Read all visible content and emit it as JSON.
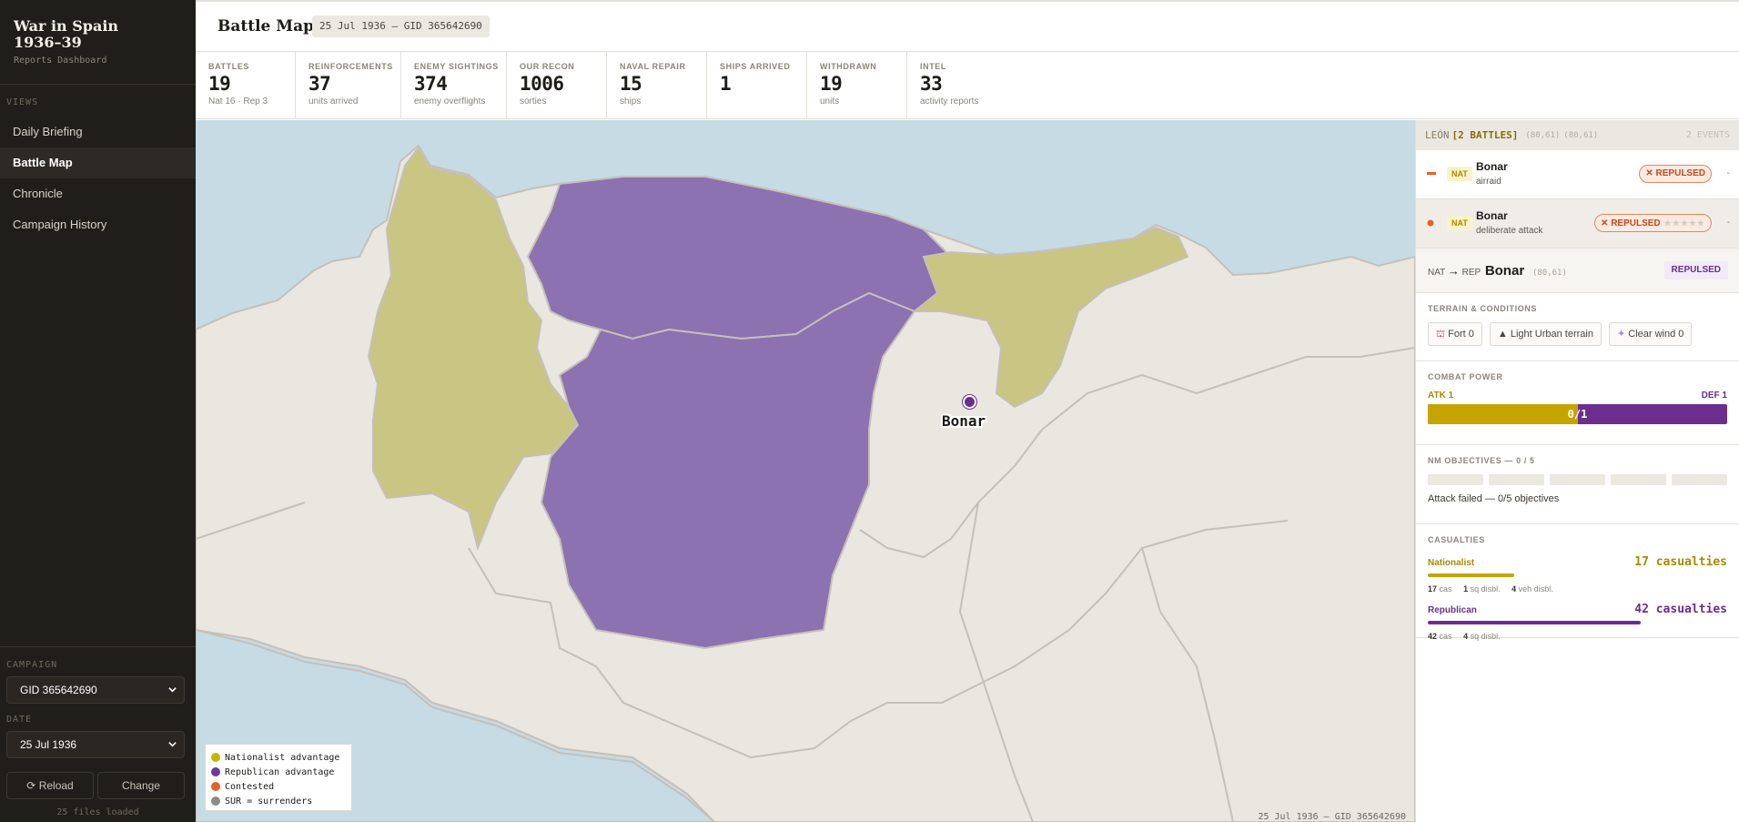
{
  "sidebar": {
    "brand_title": "War in Spain 1936–39",
    "brand_sub": "Reports Dashboard",
    "views_label": "VIEWS",
    "nav": [
      {
        "label": "Daily Briefing"
      },
      {
        "label": "Battle Map",
        "active": true
      },
      {
        "label": "Chronicle"
      },
      {
        "label": "Campaign History"
      }
    ],
    "campaign_label": "CAMPAIGN",
    "campaign_value": "GID 365642690",
    "date_label": "DATE",
    "date_value": "25 Jul 1936",
    "reload_label": "Reload",
    "change_label": "Change",
    "files_loaded": "25 files loaded"
  },
  "header": {
    "title": "Battle Map",
    "tag": "25 Jul 1936 — GID 365642690"
  },
  "stats": [
    {
      "label": "BATTLES",
      "value": "19",
      "sub": "Nat 16 · Rep 3"
    },
    {
      "label": "REINFORCEMENTS",
      "value": "37",
      "sub": "units arrived"
    },
    {
      "label": "ENEMY SIGHTINGS",
      "value": "374",
      "sub": "enemy overflights"
    },
    {
      "label": "OUR RECON",
      "value": "1006",
      "sub": "sorties"
    },
    {
      "label": "NAVAL REPAIR",
      "value": "15",
      "sub": "ships"
    },
    {
      "label": "SHIPS ARRIVED",
      "value": "1",
      "sub": ""
    },
    {
      "label": "WITHDRAWN",
      "value": "19",
      "sub": "units"
    },
    {
      "label": "INTEL",
      "value": "33",
      "sub": "activity reports"
    }
  ],
  "map": {
    "marker_label": "Bonar",
    "footer": "25 Jul 1936 — GID 365642690",
    "legend": [
      {
        "label": "Nationalist advantage",
        "color": "#c6b600"
      },
      {
        "label": "Republican advantage",
        "color": "#6b3a99"
      },
      {
        "label": "Contested",
        "color": "#e2622a"
      },
      {
        "label": "SUR = surrenders",
        "color": "#8c8c86"
      }
    ],
    "colors": {
      "sea": "#c6dbe4",
      "land": "#eae6e0",
      "border": "#c5c0b8",
      "nationalist": "#c9c583",
      "republican": "#8c72b0"
    }
  },
  "panel": {
    "place": "LEÓN",
    "battles_tag": "[2 BATTLES]",
    "coords_a": "(80,61)",
    "coords_b": "(80,61)",
    "events_count": "2 EVENTS",
    "events": [
      {
        "side": "NAT",
        "name": "Bonar",
        "type": "airraid",
        "result": "✕ REPULSED",
        "menu": "-"
      },
      {
        "side": "NAT",
        "name": "Bonar",
        "type": "deliberate attack",
        "result": "✕ REPULSED",
        "stars": "★★★★★",
        "menu": "-"
      }
    ],
    "detail": {
      "from": "NAT",
      "arrow": "→",
      "to": "REP",
      "name": "Bonar",
      "coords": "(80,61)",
      "result": "REPULSED"
    },
    "terrain_title": "TERRAIN & CONDITIONS",
    "terrain_chips": [
      "Fort 0",
      "Light Urban terrain",
      "Clear wind 0"
    ],
    "combat_title": "COMBAT POWER",
    "atk_label": "ATK 1",
    "def_label": "DEF 1",
    "power_label": "0/1",
    "atk_share": 0.5,
    "objectives_title": "NM OBJECTIVES — 0 / 5",
    "objectives_total": 5,
    "objectives_done": 0,
    "objectives_note": "Attack failed — 0/5 objectives",
    "casualties_title": "CASUALTIES",
    "casualties": [
      {
        "side": "Nationalist",
        "total": "17 casualties",
        "color": "#c6a400",
        "bar_fraction": 0.29,
        "details": [
          {
            "n": "17",
            "t": "cas"
          },
          {
            "n": "1",
            "t": "sq disbl."
          },
          {
            "n": "4",
            "t": "veh disbl."
          }
        ]
      },
      {
        "side": "Republican",
        "total": "42 casualties",
        "color": "#6b2e8f",
        "bar_fraction": 0.71,
        "details": [
          {
            "n": "42",
            "t": "cas"
          },
          {
            "n": "4",
            "t": "sq disbl."
          }
        ]
      }
    ]
  }
}
